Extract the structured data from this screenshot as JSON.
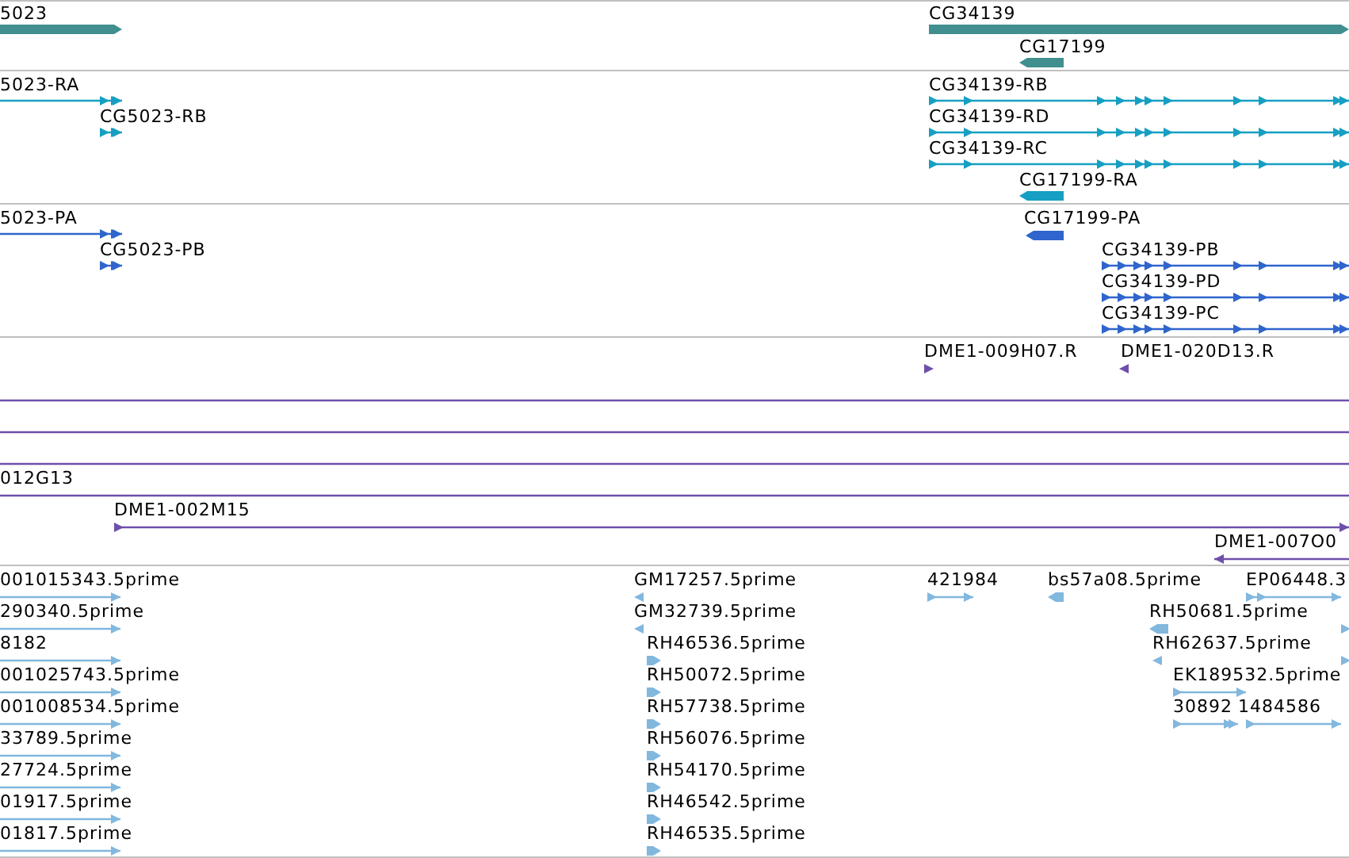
{
  "tracks": [
    {
      "kind": "gene",
      "features": [
        {
          "label": "5023",
          "kind": "bar",
          "reverse": false
        },
        {
          "label": "CG34139",
          "kind": "bar",
          "reverse": false
        },
        {
          "label": "CG17199",
          "kind": "bar",
          "reverse": true
        }
      ]
    },
    {
      "kind": "transcript",
      "features": [
        {
          "label": "5023-RA",
          "kind": "line",
          "reverse": false
        },
        {
          "label": "CG5023-RB",
          "kind": "line",
          "reverse": false
        },
        {
          "label": "CG34139-RB",
          "kind": "line",
          "reverse": false
        },
        {
          "label": "CG34139-RD",
          "kind": "line",
          "reverse": false
        },
        {
          "label": "CG34139-RC",
          "kind": "line",
          "reverse": false
        },
        {
          "label": "CG17199-RA",
          "kind": "bar",
          "reverse": true
        }
      ]
    },
    {
      "kind": "protein",
      "features": [
        {
          "label": "5023-PA",
          "kind": "line",
          "reverse": false
        },
        {
          "label": "CG5023-PB",
          "kind": "line",
          "reverse": false
        },
        {
          "label": "CG17199-PA",
          "kind": "bar",
          "reverse": true
        },
        {
          "label": "CG34139-PB",
          "kind": "line",
          "reverse": false
        },
        {
          "label": "CG34139-PD",
          "kind": "line",
          "reverse": false
        },
        {
          "label": "CG34139-PC",
          "kind": "line",
          "reverse": false
        }
      ]
    },
    {
      "kind": "clone",
      "features": [
        {
          "label": "DME1-009H07.R",
          "kind": "mark",
          "reverse": false
        },
        {
          "label": "DME1-020D13.R",
          "kind": "mark",
          "reverse": true
        },
        {
          "kind": "line"
        },
        {
          "kind": "line"
        },
        {
          "kind": "line"
        },
        {
          "label": "012G13",
          "kind": "line"
        },
        {
          "label": "DME1-002M15",
          "kind": "line",
          "reverse": false
        },
        {
          "label": "DME1-007O0",
          "kind": "line",
          "reverse": true
        }
      ]
    },
    {
      "kind": "est",
      "features": [
        {
          "label": "001015343.5prime",
          "kind": "line",
          "reverse": false
        },
        {
          "label": "290340.5prime",
          "kind": "line",
          "reverse": false
        },
        {
          "label": "8182",
          "kind": "line",
          "reverse": false
        },
        {
          "label": "001025743.5prime",
          "kind": "line",
          "reverse": false
        },
        {
          "label": "001008534.5prime",
          "kind": "line",
          "reverse": false
        },
        {
          "label": "33789.5prime",
          "kind": "line",
          "reverse": false
        },
        {
          "label": "27724.5prime",
          "kind": "line",
          "reverse": false
        },
        {
          "label": "01917.5prime",
          "kind": "line",
          "reverse": false
        },
        {
          "label": "01817.5prime",
          "kind": "line",
          "reverse": false
        },
        {
          "label": "GM17257.5prime",
          "kind": "mark",
          "reverse": true
        },
        {
          "label": "GM32739.5prime",
          "kind": "mark",
          "reverse": true
        },
        {
          "label": "RH46536.5prime",
          "kind": "bar",
          "reverse": false
        },
        {
          "label": "RH50072.5prime",
          "kind": "bar",
          "reverse": false
        },
        {
          "label": "RH57738.5prime",
          "kind": "bar",
          "reverse": false
        },
        {
          "label": "RH56076.5prime",
          "kind": "bar",
          "reverse": false
        },
        {
          "label": "RH54170.5prime",
          "kind": "bar",
          "reverse": false
        },
        {
          "label": "RH46542.5prime",
          "kind": "bar",
          "reverse": false
        },
        {
          "label": "RH46535.5prime",
          "kind": "bar",
          "reverse": false
        },
        {
          "label": "421984",
          "kind": "line",
          "reverse": false
        },
        {
          "label": "bs57a08.5prime",
          "kind": "bar",
          "reverse": true
        },
        {
          "label": "EP06448.3",
          "kind": "line",
          "reverse": false
        },
        {
          "label": "RH50681.5prime",
          "kind": "bar",
          "reverse": true
        },
        {
          "label": "RH62637.5prime",
          "kind": "mark",
          "reverse": true
        },
        {
          "label": "EK189532.5prime",
          "kind": "line",
          "reverse": false
        },
        {
          "label": "30892",
          "kind": "line",
          "reverse": false
        },
        {
          "label": "1484586",
          "kind": "line",
          "reverse": false
        },
        {
          "kind": "mark",
          "reverse": false
        },
        {
          "kind": "mark",
          "reverse": false
        }
      ]
    }
  ]
}
